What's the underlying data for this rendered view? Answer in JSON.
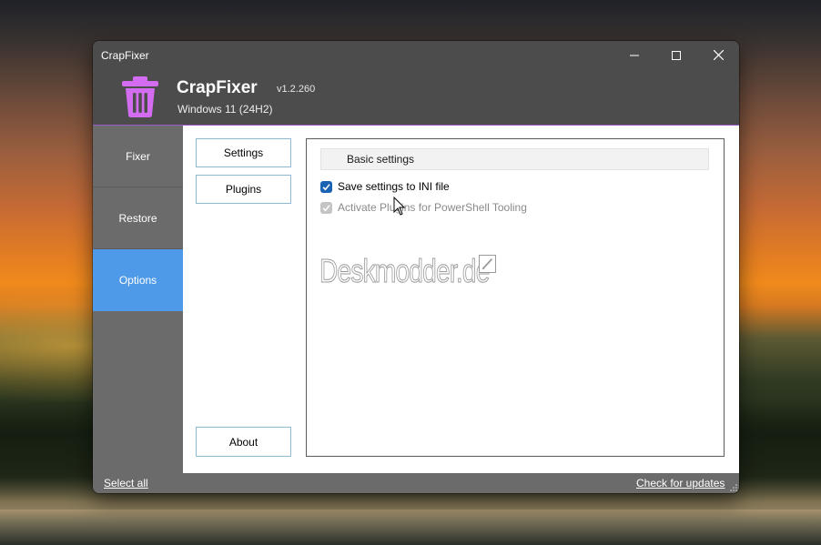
{
  "window": {
    "title": "CrapFixer",
    "controls": {
      "minimize": "minimize-icon",
      "maximize": "maximize-icon",
      "close": "close-icon"
    }
  },
  "header": {
    "app_name": "CrapFixer",
    "version": "v1.2.260",
    "os": "Windows 11 (24H2)",
    "logo_icon": "trash-icon",
    "logo_color": "#d36cf0"
  },
  "sidebar": {
    "items": [
      {
        "label": "Fixer",
        "active": false
      },
      {
        "label": "Restore",
        "active": false
      },
      {
        "label": "Options",
        "active": true
      }
    ],
    "active_color": "#4f9ae8"
  },
  "options": {
    "buttons": {
      "settings": "Settings",
      "plugins": "Plugins",
      "about": "About"
    },
    "panel": {
      "heading": "Basic settings",
      "checkboxes": [
        {
          "label": "Save settings to INI file",
          "checked": true,
          "enabled": true
        },
        {
          "label": "Activate Plugins for PowerShell Tooling",
          "checked": true,
          "enabled": false
        }
      ]
    },
    "watermark": "Deskmodder.de"
  },
  "footer": {
    "select_all": "Select all",
    "check_updates": "Check for updates"
  }
}
